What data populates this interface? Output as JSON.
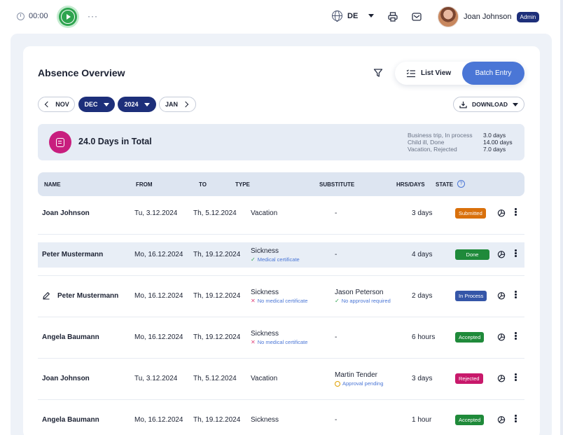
{
  "topbar": {
    "timer": "00:00",
    "more": "···",
    "language": "DE",
    "user_name": "Joan Johnson",
    "user_role": "Admin"
  },
  "page": {
    "title": "Absence Overview",
    "list_view_label": "List View",
    "batch_entry_label": "Batch Entry",
    "nav": {
      "prev_month": "NOV",
      "month": "DEC",
      "year": "2024",
      "next_month": "JAN"
    },
    "download_label": "DOWNLOAD"
  },
  "summary": {
    "total": "24.0 Days in Total",
    "breakdown": [
      {
        "label": "Business trip, In process",
        "value": "3.0 days"
      },
      {
        "label": "Child ill, Done",
        "value": "14.00 days"
      },
      {
        "label": "Vacation, Rejected",
        "value": "7.0 days"
      }
    ]
  },
  "table": {
    "headers": {
      "name": "NAME",
      "from": "FROM",
      "to": "TO",
      "type": "TYPE",
      "substitute": "SUBSTITUTE",
      "hrs_days": "HRS/DAYS",
      "state": "STATE"
    },
    "rows": [
      {
        "name": "Joan Johnson",
        "from": "Tu, 3.12.2024",
        "to": "Th, 5.12.2024",
        "type": "Vacation",
        "type_note": "",
        "substitute": "-",
        "sub_note": "",
        "duration": "3 days",
        "state": "Submitted"
      },
      {
        "name": "Peter Mustermann",
        "from": "Mo, 16.12.2024",
        "to": "Th, 19.12.2024",
        "type": "Sickness",
        "type_note": "Medical certificate",
        "substitute": "-",
        "sub_note": "",
        "duration": "4 days",
        "state": "Done"
      },
      {
        "name": "Peter Mustermann",
        "from": "Mo, 16.12.2024",
        "to": "Th, 19.12.2024",
        "type": "Sickness",
        "type_note": "No medical certificate",
        "substitute": "Jason Peterson",
        "sub_note": "No approval required",
        "duration": "2 days",
        "state": "In Process"
      },
      {
        "name": "Angela Baumann",
        "from": "Mo, 16.12.2024",
        "to": "Th, 19.12.2024",
        "type": "Sickness",
        "type_note": "No medical certificate",
        "substitute": "-",
        "sub_note": "",
        "duration": "6 hours",
        "state": "Accepted"
      },
      {
        "name": "Joan Johnson",
        "from": "Tu, 3.12.2024",
        "to": "Th, 5.12.2024",
        "type": "Vacation",
        "type_note": "",
        "substitute": "Martin Tender",
        "sub_note": "Approval pending",
        "duration": "3 days",
        "state": "Rejected"
      },
      {
        "name": "Angela Baumann",
        "from": "Mo, 16.12.2024",
        "to": "Th, 19.12.2024",
        "type": "Sickness",
        "type_note": "",
        "substitute": "-",
        "sub_note": "",
        "duration": "1 hour",
        "state": "Accepted"
      }
    ]
  },
  "colors": {
    "primary": "#1d2f7a",
    "accent": "#4a76d6",
    "submitted": "#d9700b",
    "done": "#1f8a3a",
    "in_process": "#3556a8",
    "accepted": "#1f8a3a",
    "rejected": "#c8196b"
  }
}
